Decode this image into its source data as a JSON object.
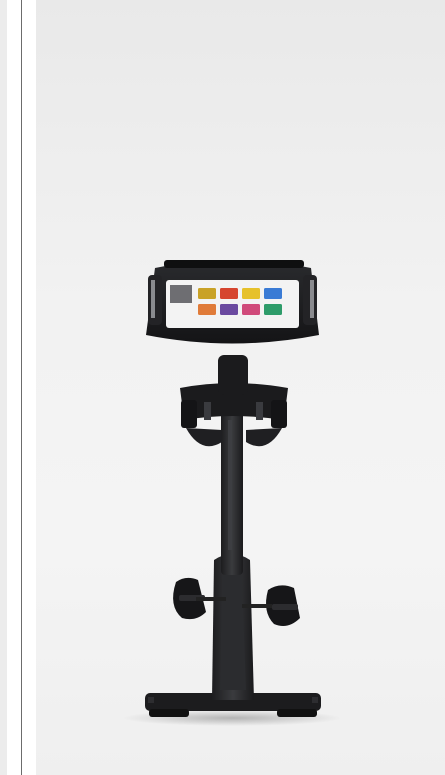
{
  "product_image": {
    "icon": "exercise-bike-image",
    "screen_tiles": [
      {
        "color": "#c9a227"
      },
      {
        "color": "#d6452f"
      },
      {
        "color": "#e6c12b"
      },
      {
        "color": "#3a7bd5"
      },
      {
        "color": "#e07b39"
      },
      {
        "color": "#6b4aa0"
      },
      {
        "color": "#d04a7a"
      },
      {
        "color": "#2e9c6a"
      }
    ]
  }
}
